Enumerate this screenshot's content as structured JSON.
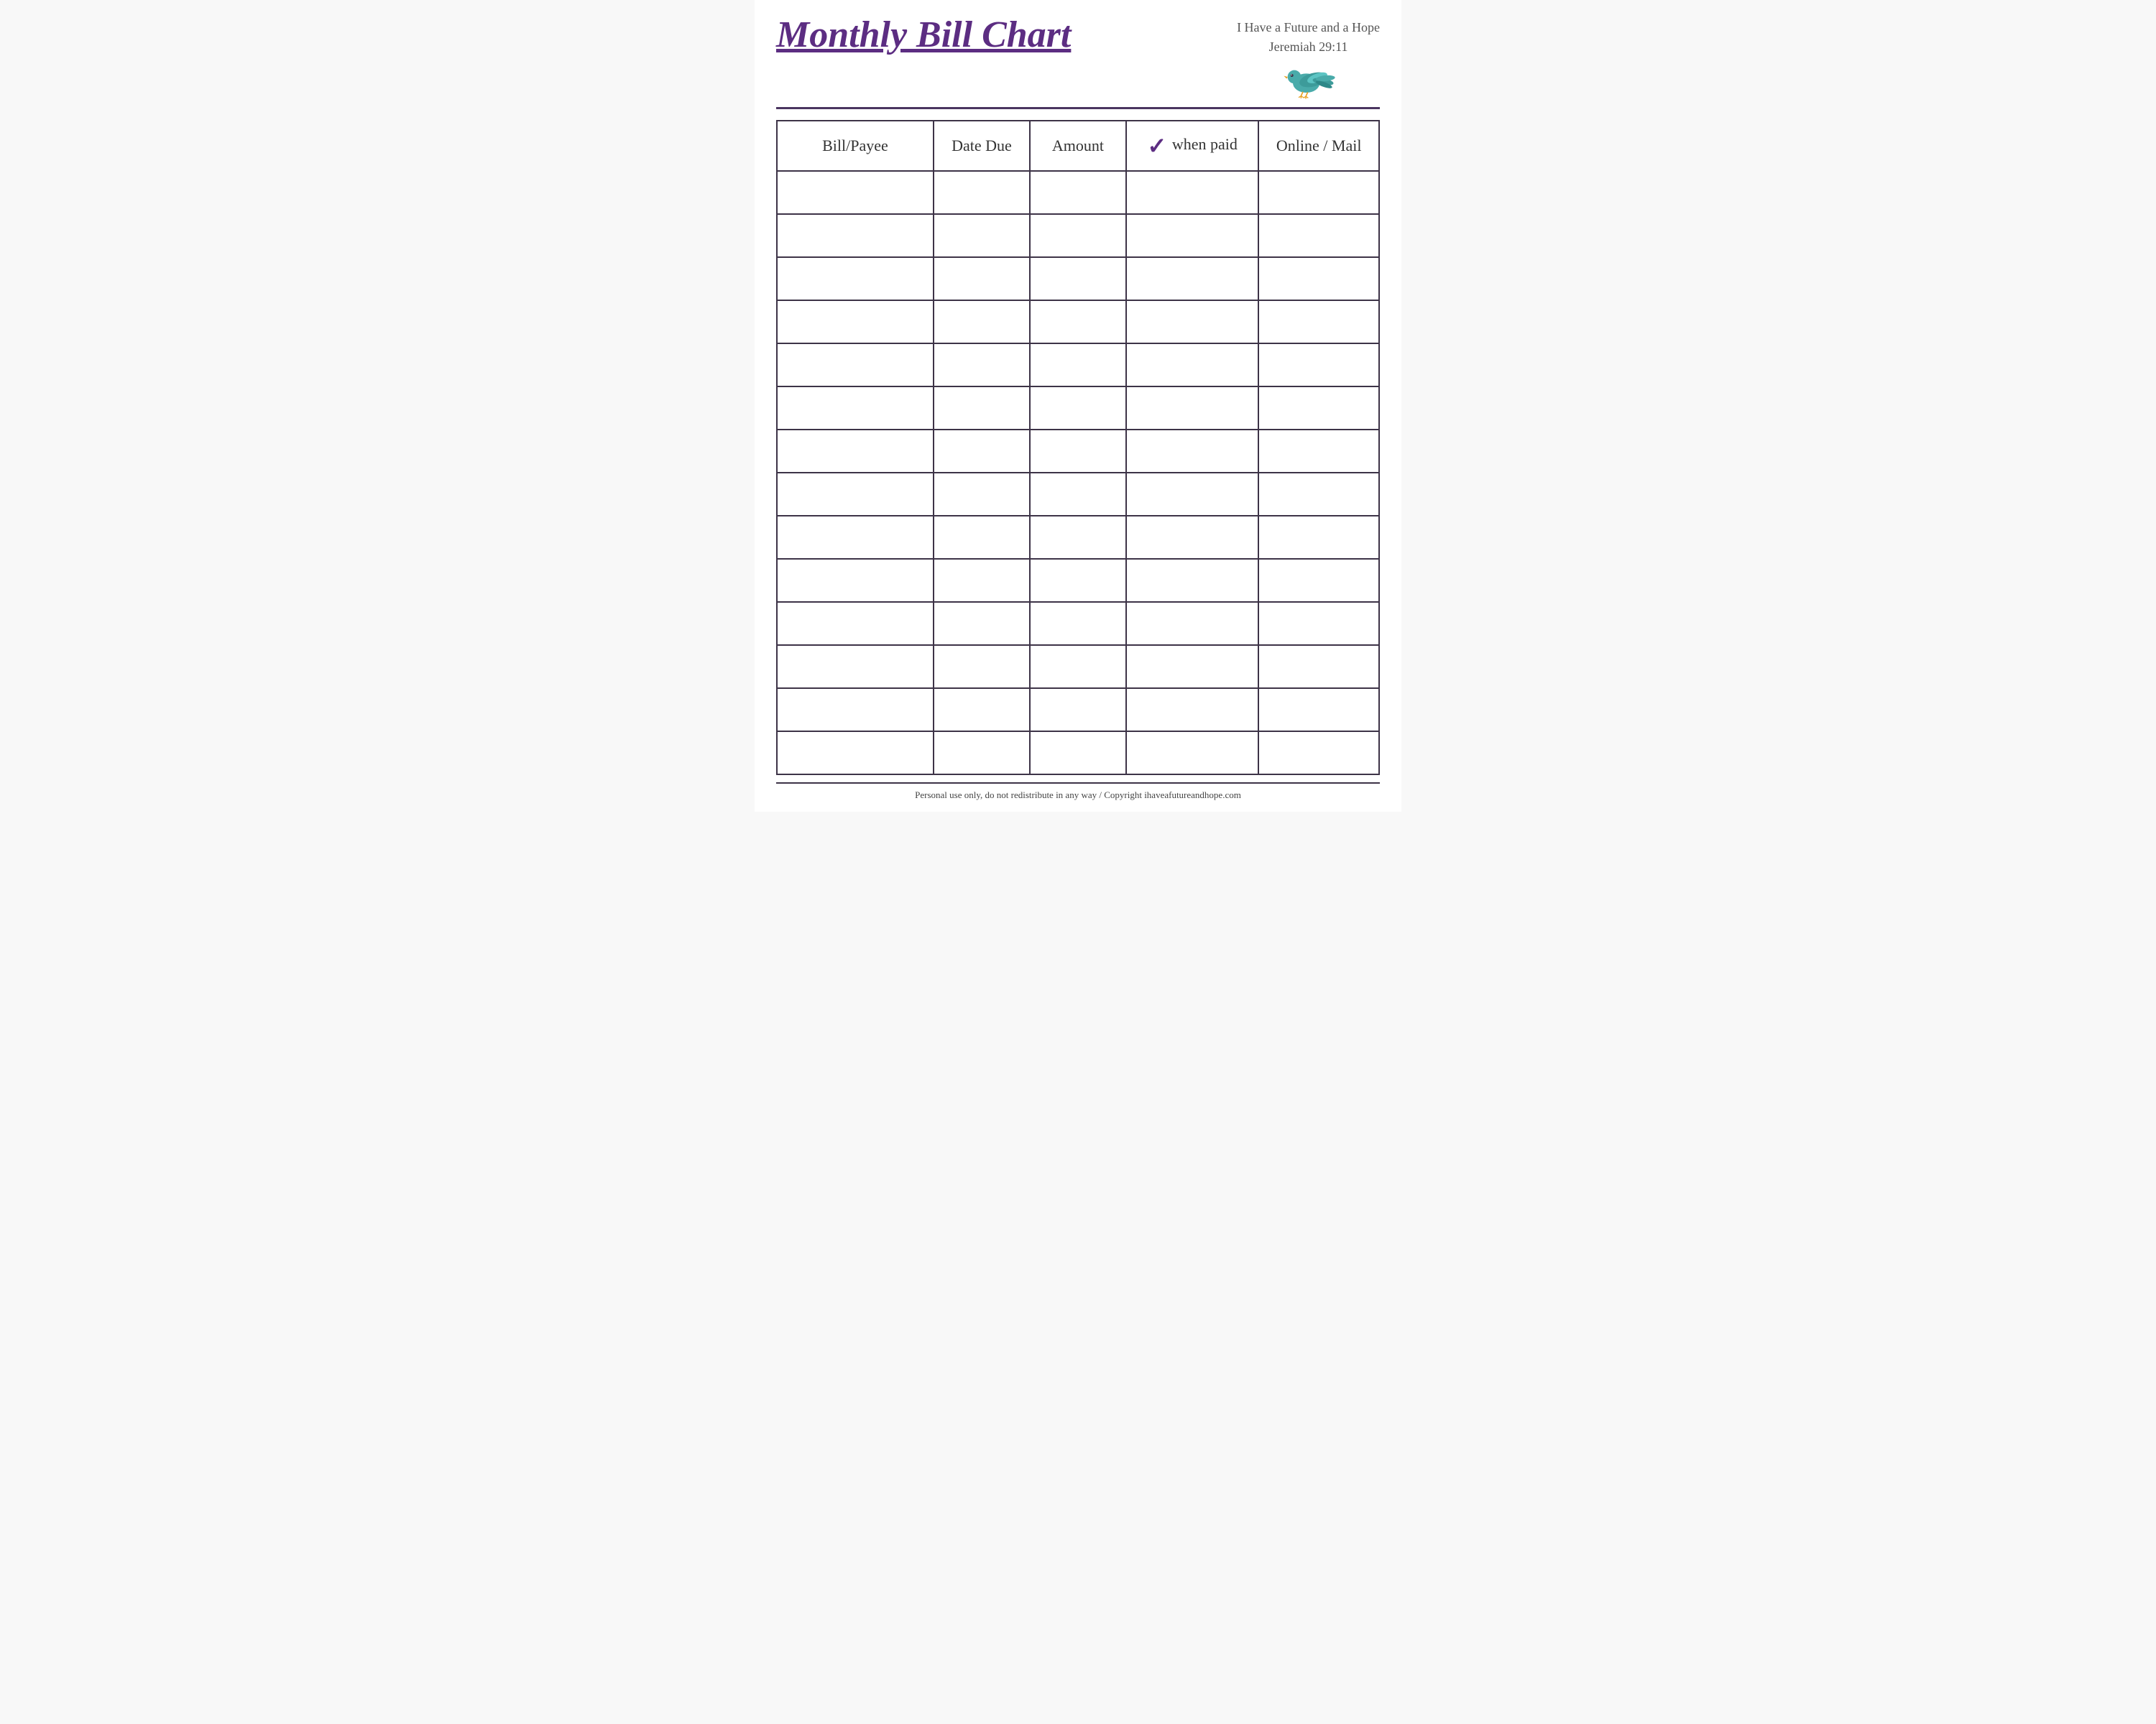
{
  "header": {
    "title": "Monthly Bill Chart",
    "subtitle_line1": "I Have a Future and a Hope",
    "subtitle_line2": "Jeremiah 29:11"
  },
  "table": {
    "columns": [
      {
        "id": "bill-payee",
        "label": "Bill/Payee"
      },
      {
        "id": "date-due",
        "label": "Date Due"
      },
      {
        "id": "amount",
        "label": "Amount"
      },
      {
        "id": "check-when-paid",
        "label": "Check when paid",
        "has_checkmark": true
      },
      {
        "id": "online-mail",
        "label": "Online / Mail"
      }
    ],
    "row_count": 14
  },
  "footer": {
    "text": "Personal use only, do not redistribute in any way / Copyright ihaveafutureandhope.com"
  },
  "colors": {
    "title": "#5c2d82",
    "border": "#3d3347",
    "checkmark": "#5c2d82",
    "text": "#333333",
    "subtitle": "#555555"
  }
}
